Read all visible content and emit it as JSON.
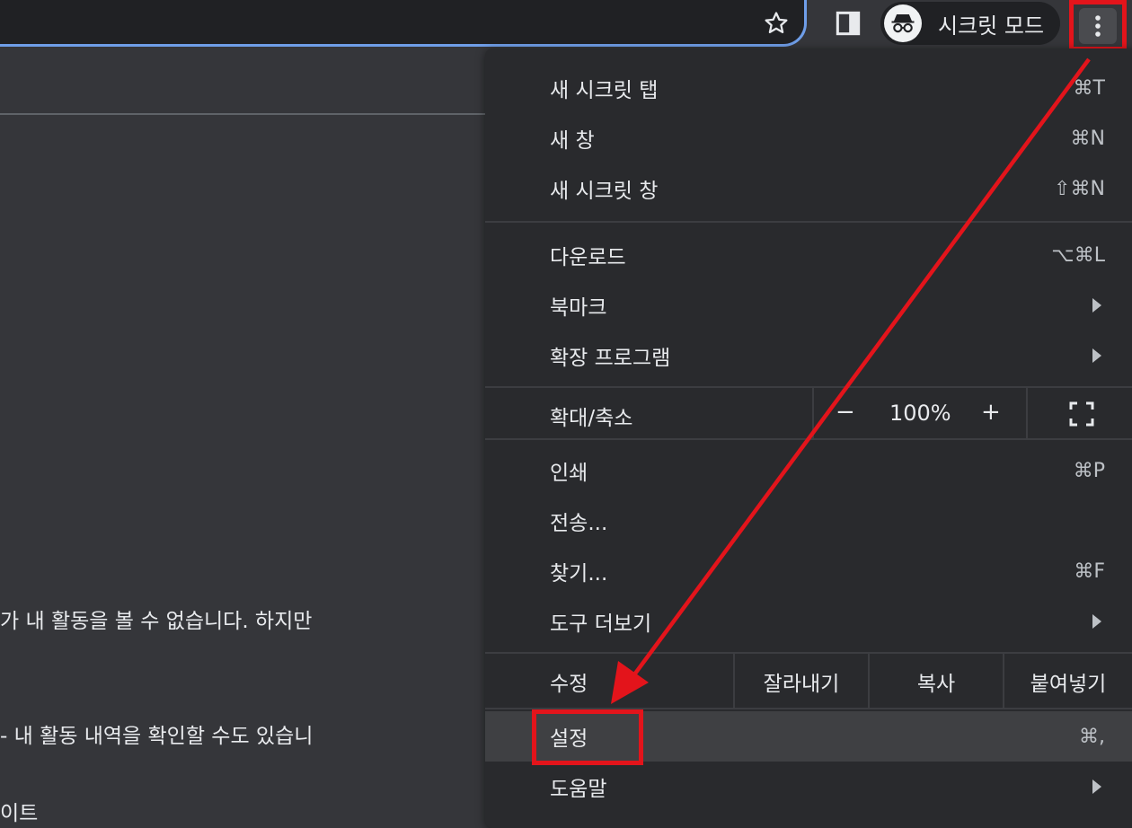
{
  "toolbar": {
    "incognito_label": "시크릿 모드"
  },
  "page": {
    "line1": "가 내 활동을 볼 수 없습니다. 하지만",
    "line2": "- 내 활동 내역을 확인할 수도 있습니",
    "line3": "이트"
  },
  "menu": {
    "new_incognito_tab": {
      "label": "새 시크릿 탭",
      "shortcut": "⌘T"
    },
    "new_window": {
      "label": "새 창",
      "shortcut": "⌘N"
    },
    "new_incognito_window": {
      "label": "새 시크릿 창",
      "shortcut": "⇧⌘N"
    },
    "downloads": {
      "label": "다운로드",
      "shortcut": "⌥⌘L"
    },
    "bookmarks": {
      "label": "북마크"
    },
    "extensions": {
      "label": "확장 프로그램"
    },
    "zoom": {
      "label": "확대/축소",
      "minus": "−",
      "value": "100%",
      "plus": "+"
    },
    "print": {
      "label": "인쇄",
      "shortcut": "⌘P"
    },
    "cast": {
      "label": "전송..."
    },
    "find": {
      "label": "찾기...",
      "shortcut": "⌘F"
    },
    "more_tools": {
      "label": "도구 더보기"
    },
    "edit": {
      "label": "수정",
      "cut": "잘라내기",
      "copy": "복사",
      "paste": "붙여넣기"
    },
    "settings": {
      "label": "설정",
      "shortcut": "⌘,"
    },
    "help": {
      "label": "도움말"
    }
  },
  "colors": {
    "annotation": "#e3141b",
    "menu_bg": "#292a2d",
    "omnibox_focus": "#6f9ee8"
  }
}
